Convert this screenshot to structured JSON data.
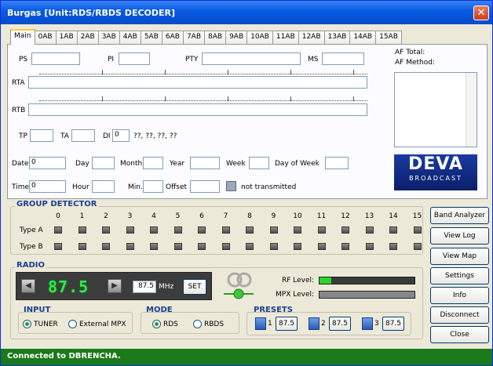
{
  "window": {
    "title": "Burgas [Unit:RDS/RBDS DECODER]"
  },
  "tabs": [
    "Main",
    "0AB",
    "1AB",
    "2AB",
    "3AB",
    "4AB",
    "5AB",
    "6AB",
    "7AB",
    "8AB",
    "9AB",
    "10AB",
    "11AB",
    "12AB",
    "13AB",
    "14AB",
    "15AB"
  ],
  "fields": {
    "ps_label": "PS",
    "pi_label": "PI",
    "pty_label": "PTY",
    "ms_label": "MS",
    "rta_label": "RTA",
    "rtb_label": "RTB",
    "tp_label": "TP",
    "ta_label": "TA",
    "di_label": "DI",
    "di_value": "0",
    "di_flags": "??, ??, ??, ??",
    "date_label": "Date",
    "date_value": "0",
    "day_label": "Day",
    "month_label": "Month",
    "year_label": "Year",
    "week_label": "Week",
    "dow_label": "Day of Week",
    "time_label": "Time",
    "time_value": "0",
    "hour_label": "Hour",
    "min_label": "Min.",
    "offset_label": "Offset",
    "time_status": "not transmitted"
  },
  "af": {
    "total_label": "AF Total:",
    "method_label": "AF Method:"
  },
  "logo": {
    "main": "DEVA",
    "sub": "BROADCAST"
  },
  "group_detector": {
    "title": "GROUP DETECTOR",
    "numbers": [
      "0",
      "1",
      "2",
      "3",
      "4",
      "5",
      "6",
      "7",
      "8",
      "9",
      "10",
      "11",
      "12",
      "13",
      "14",
      "15"
    ],
    "row_a": "Type A",
    "row_b": "Type B"
  },
  "radio": {
    "title": "RADIO",
    "frequency_display": "87.5",
    "frequency_input": "87.5",
    "unit": "MHz",
    "set_label": "SET",
    "rf_label": "RF Level:",
    "mpx_label": "MPX Level:",
    "rf_level": 0.12,
    "mpx_level": 0.0
  },
  "input": {
    "title": "INPUT",
    "tuner": "TUNER",
    "external": "External MPX",
    "selected": "TUNER"
  },
  "mode": {
    "title": "MODE",
    "rds": "RDS",
    "rbds": "RBDS",
    "selected": "RDS"
  },
  "presets": {
    "title": "PRESETS",
    "items": [
      {
        "n": "1",
        "v": "87.5"
      },
      {
        "n": "2",
        "v": "87.5"
      },
      {
        "n": "3",
        "v": "87.5"
      }
    ]
  },
  "buttons": {
    "band_analyzer": "Band Analyzer",
    "view_log": "View Log",
    "view_map": "View Map",
    "settings": "Settings",
    "info": "Info",
    "disconnect": "Disconnect",
    "close": "Close"
  },
  "status": "Connected to DBRENCHA."
}
